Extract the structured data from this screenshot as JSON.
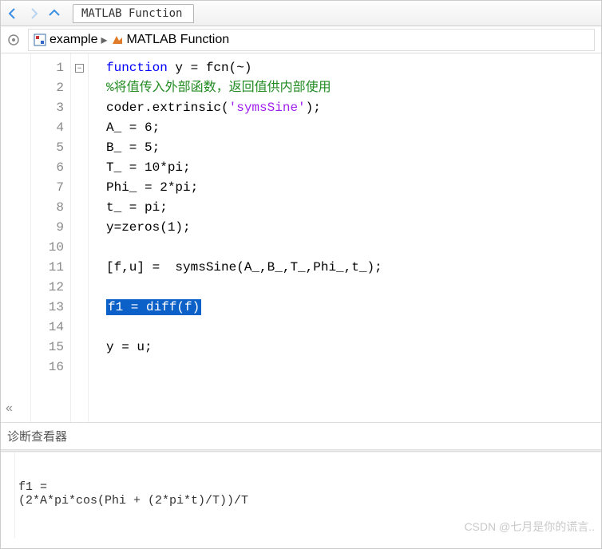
{
  "tab": {
    "title": "MATLAB Function"
  },
  "breadcrumb": {
    "item1": "example",
    "item2": "MATLAB Function"
  },
  "code": {
    "lines_count": 16,
    "l1a": "function",
    "l1b": " y = fcn(~)",
    "l2": "%将值传入外部函数，返回值供内部使用",
    "l3a": "coder.extrinsic(",
    "l3b": "'symsSine'",
    "l3c": ");",
    "l4": "A_ = 6;",
    "l5": "B_ = 5;",
    "l6": "T_ = 10*pi;",
    "l7": "Phi_ = 2*pi;",
    "l8": "t_ = pi;",
    "l9": "y=zeros(1);",
    "l10": "",
    "l11": "[f,u] =  symsSine(A_,B_,T_,Phi_,t_);",
    "l12": "",
    "l13": "f1 = diff(f)",
    "l14": "",
    "l15": "y = u;",
    "l16": ""
  },
  "line_labels": [
    "1",
    "2",
    "3",
    "4",
    "5",
    "6",
    "7",
    "8",
    "9",
    "10",
    "11",
    "12",
    "13",
    "14",
    "15",
    "16"
  ],
  "diagnostics": {
    "header": "诊断查看器",
    "output_line1": "f1 =",
    "output_line2": "(2*A*pi*cos(Phi + (2*pi*t)/T))/T"
  },
  "watermark": "CSDN @七月是你的谎言.."
}
